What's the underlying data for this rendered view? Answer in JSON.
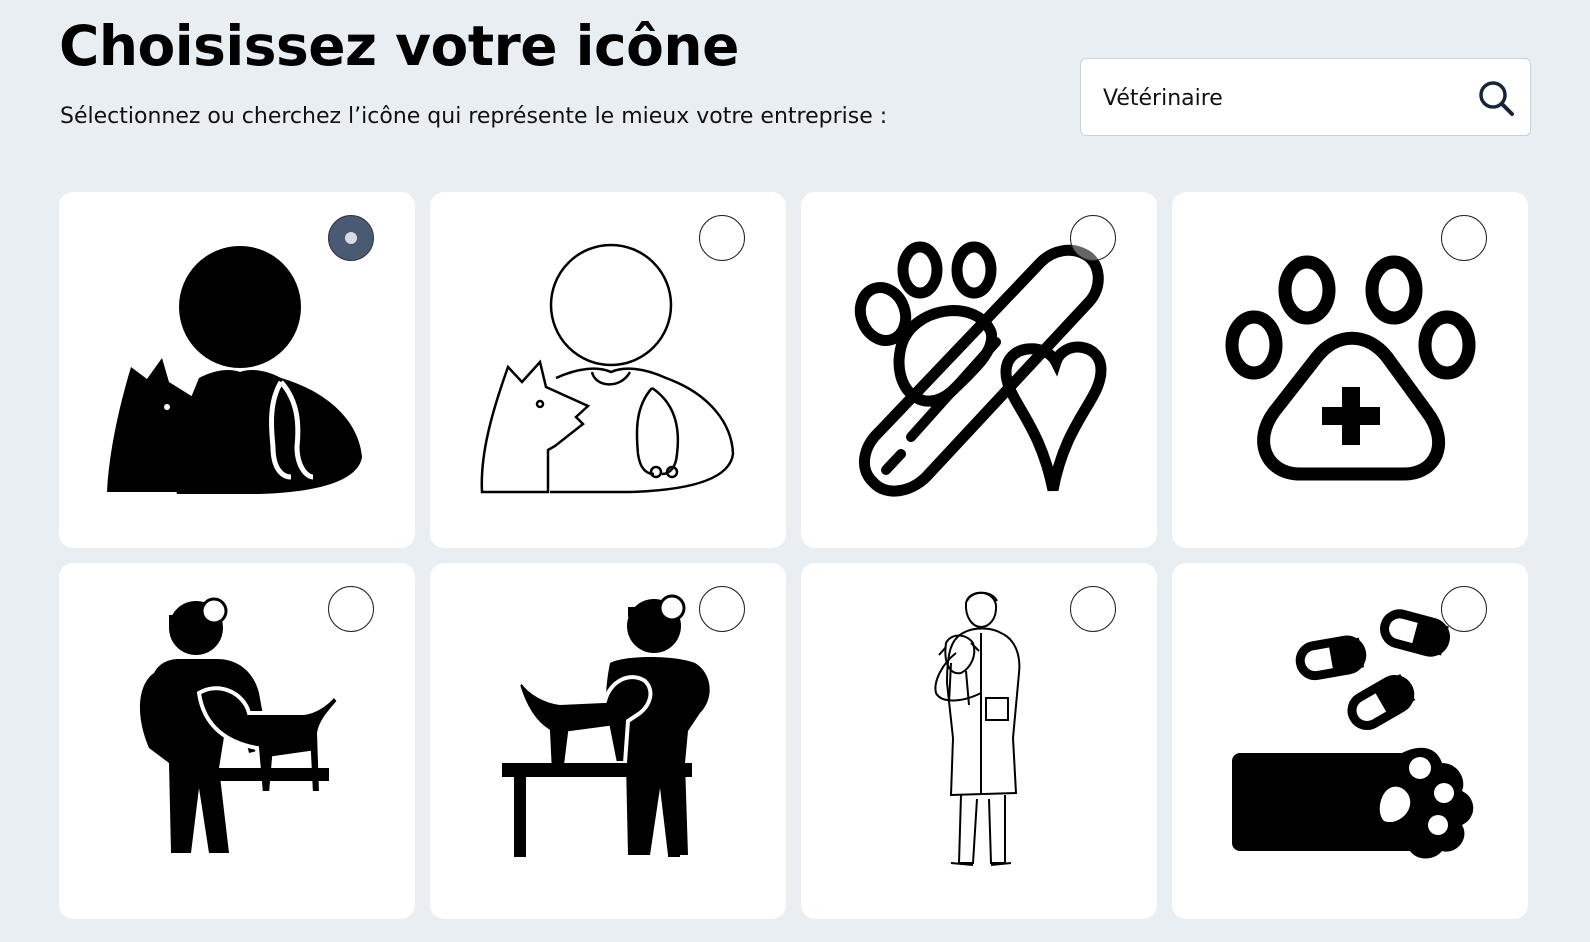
{
  "header": {
    "title": "Choisissez votre icône",
    "subtitle": "Sélectionnez ou cherchez l’icône qui représente le mieux votre entreprise :"
  },
  "search": {
    "value": "Vétérinaire",
    "icon": "search-icon"
  },
  "icons": [
    {
      "icon": "veterinarian-dog-solid-icon",
      "selected": true
    },
    {
      "icon": "veterinarian-dog-outline-icon",
      "selected": false
    },
    {
      "icon": "paw-thermometer-heart-icon",
      "selected": false
    },
    {
      "icon": "paw-medical-cross-icon",
      "selected": false
    },
    {
      "icon": "vet-examining-dog-icon",
      "selected": false
    },
    {
      "icon": "vet-examining-dog-on-table-icon",
      "selected": false
    },
    {
      "icon": "vet-holding-puppy-icon",
      "selected": false
    },
    {
      "icon": "pills-paw-bandage-icon",
      "selected": false
    }
  ]
}
